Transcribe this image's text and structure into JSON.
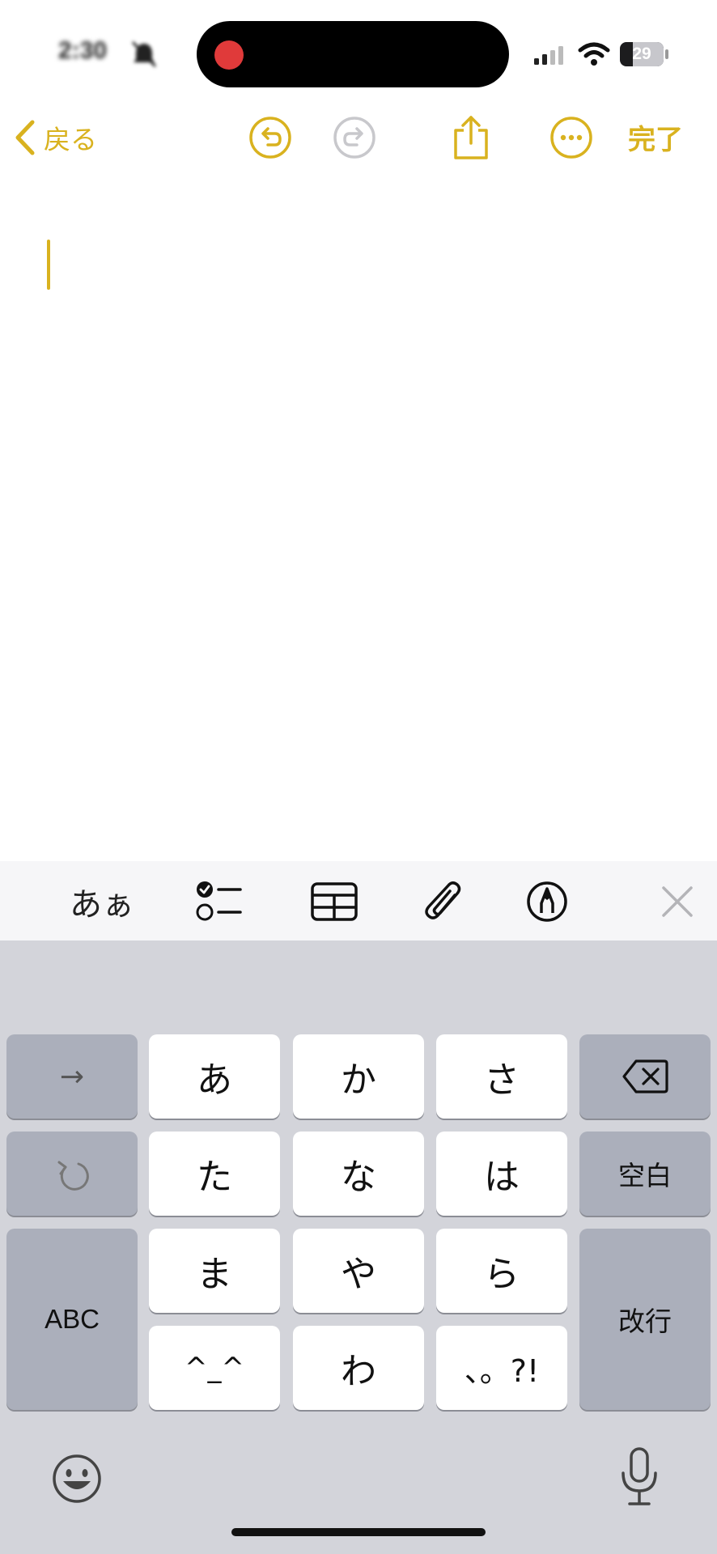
{
  "status_bar": {
    "time": "2:30",
    "battery": "29",
    "accent_recording": "#e03a3a"
  },
  "toolbar": {
    "back_label": "戻る",
    "done_label": "完了",
    "icons": [
      "chevron-left-icon",
      "undo-icon",
      "redo-icon",
      "share-icon",
      "more-icon"
    ],
    "accent_color": "#d9b21f"
  },
  "format_bar": {
    "text_style_label": "あぁ",
    "icons": [
      "checklist-icon",
      "table-icon",
      "paperclip-icon",
      "markup-pen-icon",
      "close-icon"
    ]
  },
  "keyboard": {
    "row1": [
      "→",
      "あ",
      "か",
      "さ"
    ],
    "row2": [
      "た",
      "な",
      "は",
      "空白"
    ],
    "row3": [
      "ABC",
      "ま",
      "や",
      "ら",
      "改行"
    ],
    "row4": [
      "^_^",
      "わ",
      "、。?!"
    ],
    "icons": [
      "delete-icon",
      "undo-arrow-icon",
      "emoji-icon",
      "microphone-icon"
    ]
  }
}
